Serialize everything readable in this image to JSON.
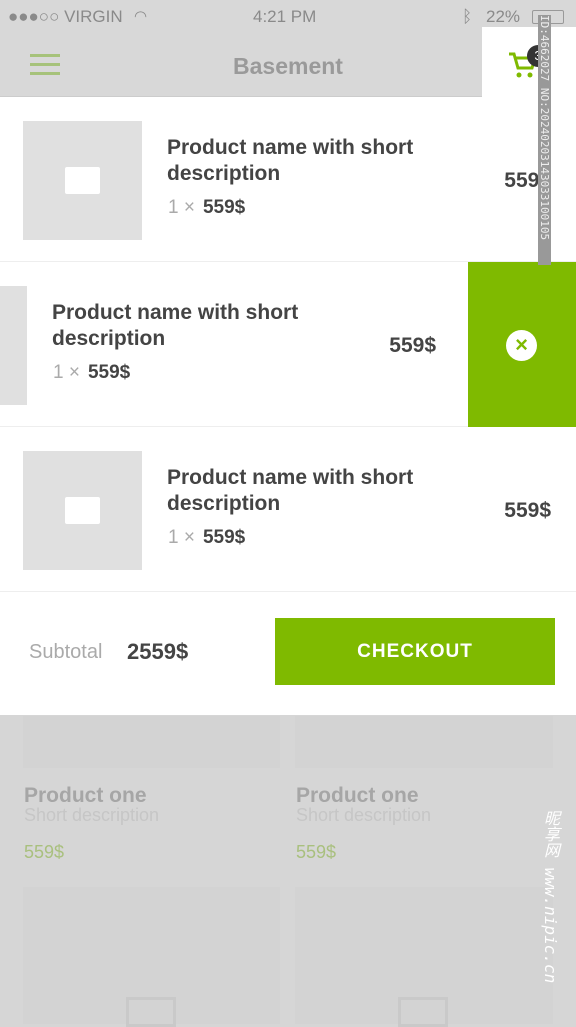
{
  "status_bar": {
    "carrier": "●●●○○ VIRGIN",
    "time": "4:21 PM",
    "battery": "22%"
  },
  "header": {
    "title": "Basement",
    "cart_count": "3"
  },
  "cart": {
    "items": [
      {
        "name": "Product name with short description",
        "qty": "1 ×",
        "unit_price": "559$",
        "price": "559$"
      },
      {
        "name": "Product name with short description",
        "qty": "1 ×",
        "unit_price": "559$",
        "price": "559$"
      },
      {
        "name": "Product name with short description",
        "qty": "1 ×",
        "unit_price": "559$",
        "price": "559$"
      }
    ],
    "subtotal_label": "Subtotal",
    "subtotal": "2559$",
    "checkout_label": "CHECKOUT"
  },
  "grid": [
    {
      "name": "Product one",
      "desc": "Short description",
      "price": "559$"
    },
    {
      "name": "Product one",
      "desc": "Short description",
      "price": "559$"
    }
  ],
  "colors": {
    "accent": "#7fba00"
  },
  "watermark": {
    "id": "ID:4662027 NO:20240203143033100105",
    "site": "昵享网 www.nipic.cn"
  }
}
